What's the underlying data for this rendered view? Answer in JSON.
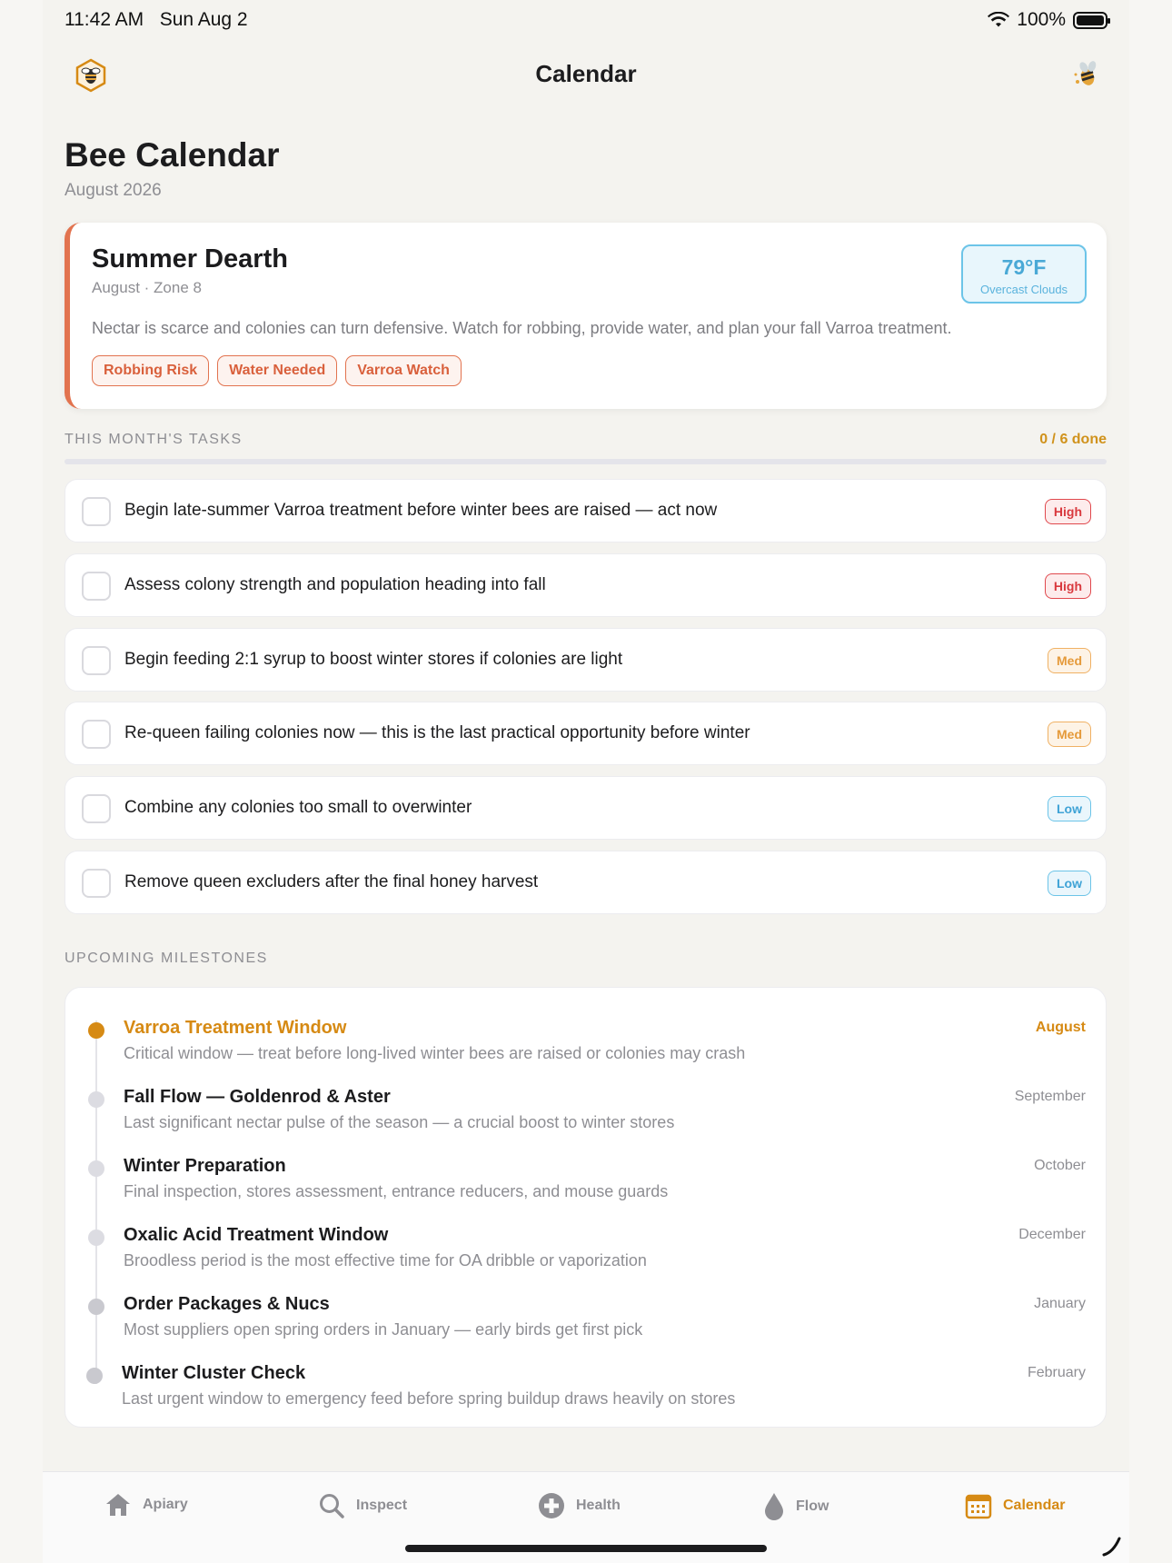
{
  "status": {
    "time": "11:42 AM",
    "date": "Sun Aug 2",
    "battery": "100%"
  },
  "nav": {
    "title": "Calendar",
    "left_icon": "hex-bee-icon",
    "right_icon": "bee-icon"
  },
  "page": {
    "title": "Bee Calendar",
    "subtitle": "August 2026"
  },
  "season": {
    "name": "Summer Dearth",
    "meta": "August · Zone 8",
    "description": "Nectar is scarce and colonies can turn defensive. Watch for robbing, provide water, and plan your fall Varroa treatment.",
    "tags": [
      "Robbing Risk",
      "Water Needed",
      "Varroa Watch"
    ],
    "weather": {
      "temp": "79°F",
      "condition": "Overcast Clouds"
    },
    "accent": "#e2734f"
  },
  "tasks_section": {
    "label": "THIS MONTH'S TASKS",
    "done": "0 / 6 done",
    "progress": 0,
    "items": [
      {
        "text": "Begin late-summer Varroa treatment before winter bees are raised — act now",
        "priority": "High"
      },
      {
        "text": "Assess colony strength and population heading into fall",
        "priority": "High"
      },
      {
        "text": "Begin feeding 2:1 syrup to boost winter stores if colonies are light",
        "priority": "Med"
      },
      {
        "text": "Re-queen failing colonies now — this is the last practical opportunity before winter",
        "priority": "Med"
      },
      {
        "text": "Combine any colonies too small to overwinter",
        "priority": "Low"
      },
      {
        "text": "Remove queen excluders after the final honey harvest",
        "priority": "Low"
      }
    ]
  },
  "milestones_section": {
    "label": "UPCOMING MILESTONES",
    "items": [
      {
        "title": "Varroa Treatment Window",
        "description": "Critical window — treat before long-lived winter bees are raised or colonies may crash",
        "month": "August",
        "active": true
      },
      {
        "title": "Fall Flow — Goldenrod & Aster",
        "description": "Last significant nectar pulse of the season — a crucial boost to winter stores",
        "month": "September",
        "active": false
      },
      {
        "title": "Winter Preparation",
        "description": "Final inspection, stores assessment, entrance reducers, and mouse guards",
        "month": "October",
        "active": false
      },
      {
        "title": "Oxalic Acid Treatment Window",
        "description": "Broodless period is the most effective time for OA dribble or vaporization",
        "month": "December",
        "active": false
      },
      {
        "title": "Order Packages & Nucs",
        "description": "Most suppliers open spring orders in January — early birds get first pick",
        "month": "January",
        "active": false
      },
      {
        "title": "Winter Cluster Check",
        "description": "Last urgent window to emergency feed before spring buildup draws heavily on stores",
        "month": "February",
        "active": false
      }
    ]
  },
  "tabbar": {
    "tabs": [
      {
        "label": "Apiary",
        "icon": "house-icon",
        "active": false
      },
      {
        "label": "Inspect",
        "icon": "magnifier-icon",
        "active": false
      },
      {
        "label": "Health",
        "icon": "plus-circle-icon",
        "active": false
      },
      {
        "label": "Flow",
        "icon": "drop-icon",
        "active": false
      },
      {
        "label": "Calendar",
        "icon": "calendar-icon",
        "active": true
      }
    ]
  },
  "colors": {
    "accent": "#d68a14",
    "high": "#d9393e",
    "med": "#e59a3a",
    "low": "#3fa3d6"
  }
}
